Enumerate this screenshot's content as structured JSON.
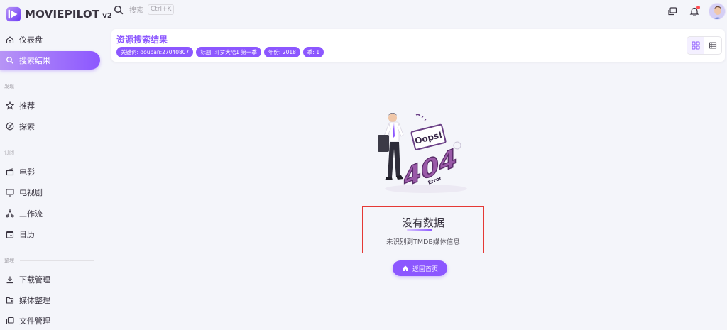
{
  "app": {
    "name": "MOVIEPILOT",
    "version": "v2"
  },
  "topbar": {
    "search_placeholder": "搜索",
    "search_shortcut": "Ctrl+K"
  },
  "sidebar": {
    "dashboard": "仪表盘",
    "search_results": "搜索结果",
    "section_discover": "发现",
    "recommend": "推荐",
    "explore": "探索",
    "section_subscribe": "订阅",
    "movies": "电影",
    "tv": "电视剧",
    "workflow": "工作流",
    "calendar": "日历",
    "section_organize": "整理",
    "downloads": "下载管理",
    "media_organize": "媒体整理",
    "file_manager": "文件管理"
  },
  "header": {
    "title": "资源搜索结果",
    "chips": [
      "关键词: douban:27040807",
      "标题: 斗罗大陆1 第一季",
      "年份: 2018",
      "季: 1"
    ]
  },
  "empty_state": {
    "image_text": {
      "bubble": "Oops!",
      "code": "404",
      "label": "Error"
    },
    "title": "没有数据",
    "subtitle": "未识别到TMDB媒体信息",
    "button": "返回首页"
  },
  "colors": {
    "accent": "#8c57ff",
    "accent_light": "#b794f6",
    "highlight_border": "#e53935",
    "notification": "#ff4c51"
  }
}
